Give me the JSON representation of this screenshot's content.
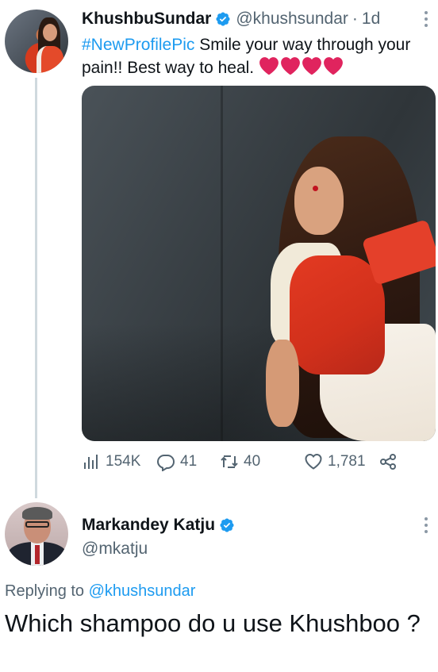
{
  "tweet": {
    "author_name": "KhushbuSundar",
    "author_handle": "@khushsundar",
    "time_separator": "·",
    "time": "1d",
    "hashtag": "#NewProfilePic",
    "text": " Smile your way through your pain!! Best way to heal. ",
    "hearts": [
      "heart",
      "heart",
      "heart",
      "heart"
    ],
    "stats": {
      "views": "154K",
      "replies": "41",
      "retweets": "40",
      "likes": "1,781"
    }
  },
  "reply": {
    "author_name": "Markandey Katju",
    "author_handle": "@mkatju",
    "replying_prefix": "Replying to ",
    "replying_to": "@khushsundar",
    "text": "Which shampoo do u use Khushboo ?"
  },
  "colors": {
    "link_blue": "#1d9bf0",
    "muted_gray": "#536471",
    "heart_red": "#e0245e"
  }
}
